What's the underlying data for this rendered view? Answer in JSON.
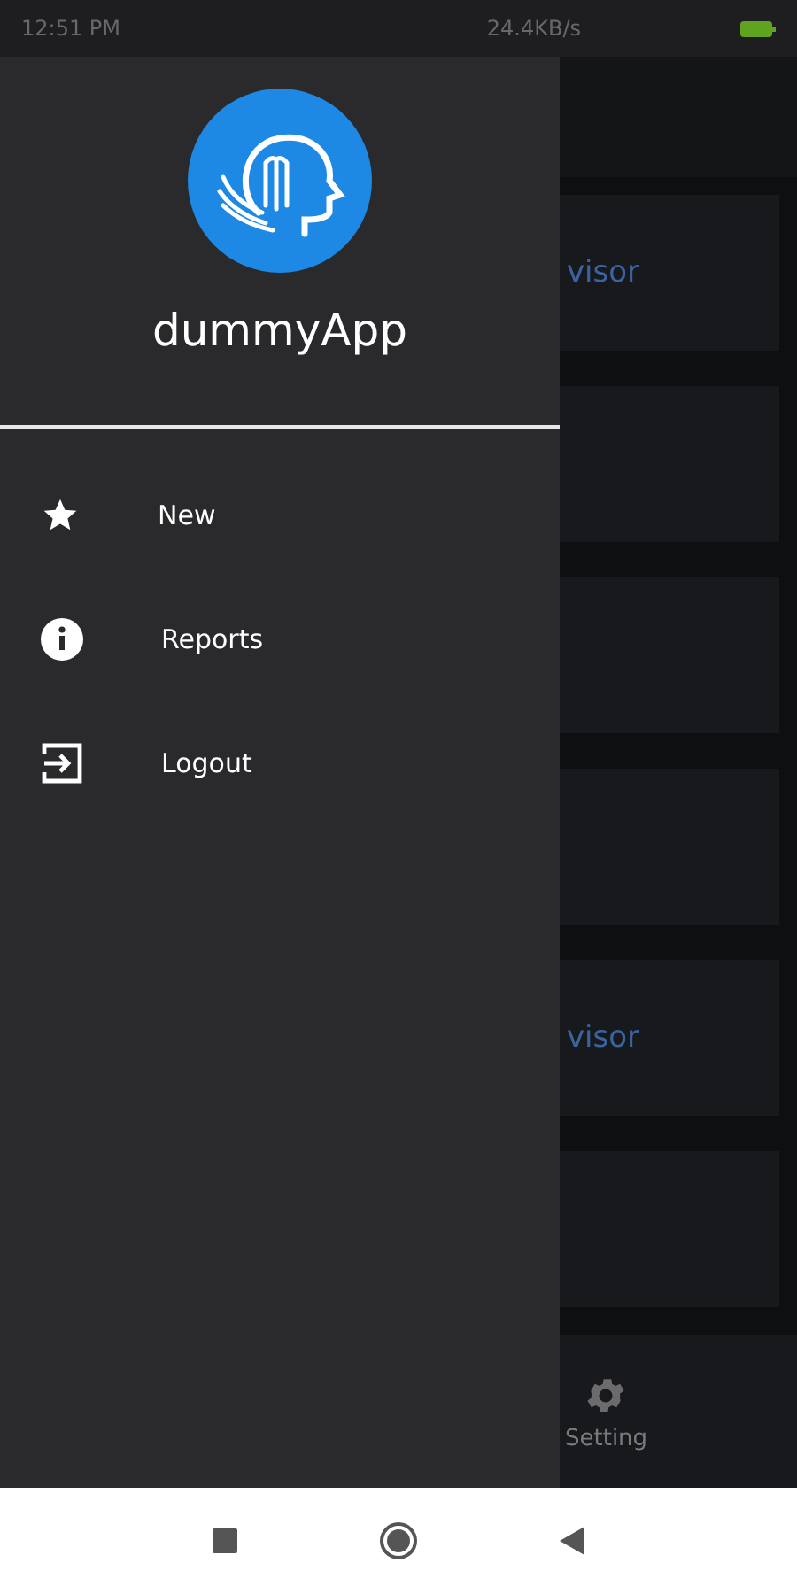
{
  "status_bar": {
    "time": "12:51 PM",
    "speed": "24.4KB/s"
  },
  "drawer": {
    "app_name": "dummyApp",
    "items": [
      {
        "label": "New",
        "kind": "star"
      },
      {
        "label": "Reports",
        "kind": "info"
      },
      {
        "label": "Logout",
        "kind": "exit"
      }
    ]
  },
  "background": {
    "cards": [
      {
        "kind": "text",
        "text": "visor"
      },
      {
        "kind": "blank"
      },
      {
        "kind": "blank"
      },
      {
        "kind": "blank"
      },
      {
        "kind": "text",
        "text": "visor"
      },
      {
        "kind": "blank"
      }
    ],
    "tab": {
      "label": "Setting"
    }
  }
}
